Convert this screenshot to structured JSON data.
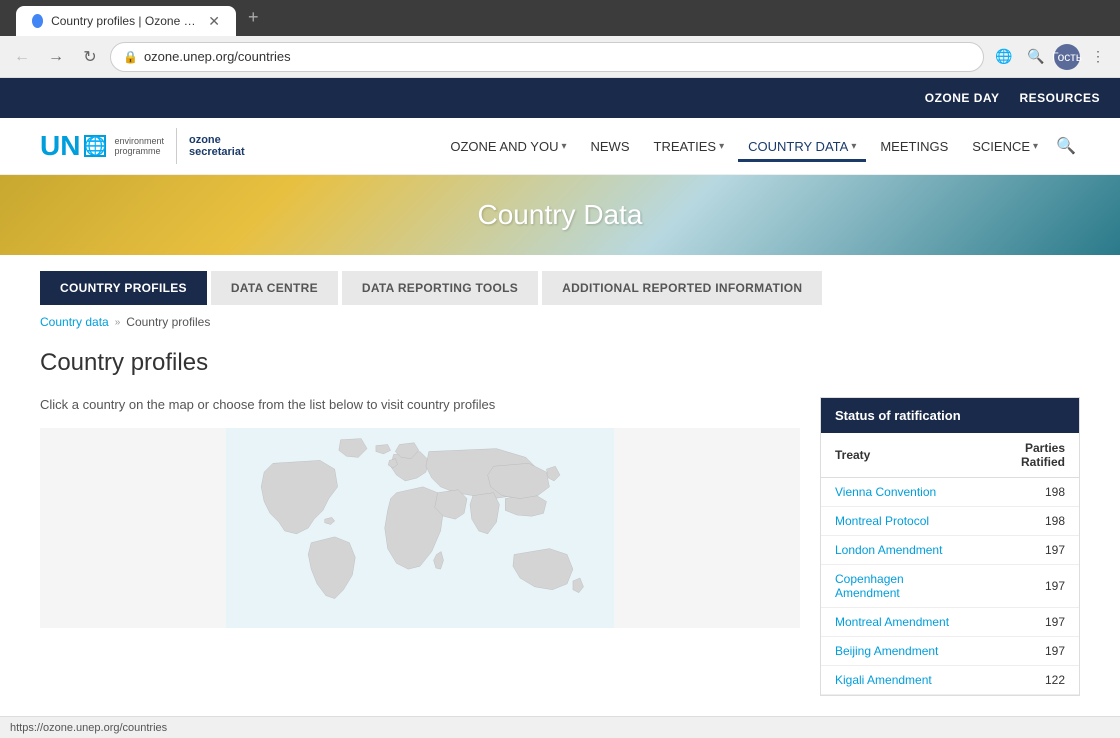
{
  "browser": {
    "tab_title": "Country profiles | Ozone Secreta...",
    "favicon_color": "#4285f4",
    "address": "ozone.unep.org/countries",
    "user_label": "Гость",
    "new_tab_icon": "+"
  },
  "top_nav": {
    "items": [
      {
        "label": "OZONE DAY",
        "key": "ozone-day"
      },
      {
        "label": "RESOURCES",
        "key": "resources"
      }
    ]
  },
  "main_header": {
    "logo_un": "UN",
    "logo_line1": "environment",
    "logo_line2": "programme",
    "logo_ozone_line1": "ozone",
    "logo_ozone_line2": "secretariat",
    "nav_items": [
      {
        "label": "OZONE AND YOU",
        "has_dropdown": true,
        "active": false
      },
      {
        "label": "NEWS",
        "has_dropdown": false,
        "active": false
      },
      {
        "label": "TREATIES",
        "has_dropdown": true,
        "active": false
      },
      {
        "label": "COUNTRY DATA",
        "has_dropdown": true,
        "active": true
      },
      {
        "label": "MEETINGS",
        "has_dropdown": false,
        "active": false
      },
      {
        "label": "SCIENCE",
        "has_dropdown": true,
        "active": false
      }
    ]
  },
  "hero": {
    "title": "Country Data"
  },
  "sub_tabs": [
    {
      "label": "COUNTRY PROFILES",
      "active": true
    },
    {
      "label": "DATA CENTRE",
      "active": false
    },
    {
      "label": "DATA REPORTING TOOLS",
      "active": false
    },
    {
      "label": "ADDITIONAL REPORTED INFORMATION",
      "active": false
    }
  ],
  "breadcrumb": {
    "items": [
      {
        "label": "Country data",
        "link": true
      },
      {
        "label": "Country profiles",
        "link": false
      }
    ],
    "separator": "»"
  },
  "page_title": "Country profiles",
  "map_instruction": "Click a country on the map or choose from the list below to visit country profiles",
  "status_table": {
    "header": "Status of ratification",
    "col_treaty": "Treaty",
    "col_parties": "Parties Ratified",
    "rows": [
      {
        "treaty": "Vienna Convention",
        "parties": "198"
      },
      {
        "treaty": "Montreal Protocol",
        "parties": "198"
      },
      {
        "treaty": "London Amendment",
        "parties": "197"
      },
      {
        "treaty": "Copenhagen Amendment",
        "parties": "197"
      },
      {
        "treaty": "Montreal Amendment",
        "parties": "197"
      },
      {
        "treaty": "Beijing Amendment",
        "parties": "197"
      },
      {
        "treaty": "Kigali Amendment",
        "parties": "122"
      }
    ]
  },
  "status_bar": {
    "url": "https://ozone.unep.org/countries"
  }
}
